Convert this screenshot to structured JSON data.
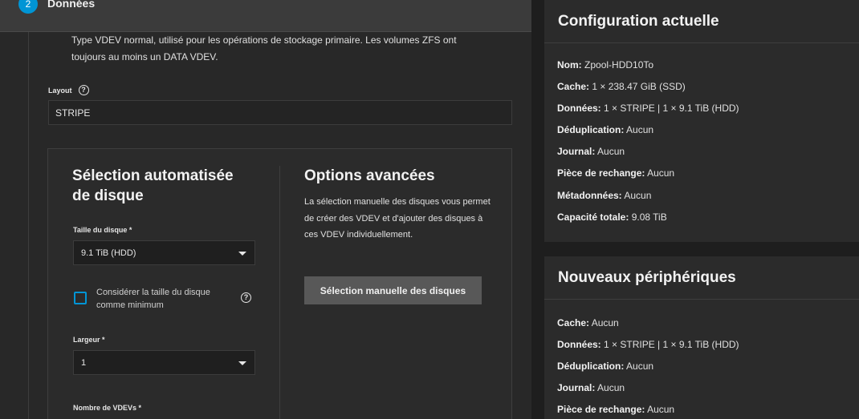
{
  "step": {
    "number": "2",
    "title": "Données"
  },
  "description": "Type VDEV normal, utilisé pour les opérations de stockage primaire. Les volumes ZFS ont toujours au moins un DATA VDEV.",
  "layout": {
    "label": "Layout",
    "value": "STRIPE"
  },
  "auto": {
    "title_line1": "Sélection automatisée",
    "title_line2": "de disque",
    "disk_size_label": "Taille du disque *",
    "disk_size_value": "9.1 TiB (HDD)",
    "min_checkbox_label": "Considérer la taille du disque comme minimum",
    "width_label": "Largeur *",
    "width_value": "1",
    "vdev_count_label": "Nombre de VDEVs *"
  },
  "advanced": {
    "title": "Options avancées",
    "description": "La sélection manuelle des disques vous permet de créer des VDEV et d'ajouter des disques à ces VDEV individuellement.",
    "button": "Sélection manuelle des disques"
  },
  "current_config": {
    "title": "Configuration actuelle",
    "rows": [
      {
        "label": "Nom:",
        "value": "Zpool-HDD10To"
      },
      {
        "label": "Cache:",
        "value": "1 × 238.47 GiB (SSD)"
      },
      {
        "label": "Données:",
        "value": "1 × STRIPE | 1 × 9.1 TiB (HDD)"
      },
      {
        "label": "Déduplication:",
        "value": "Aucun"
      },
      {
        "label": "Journal:",
        "value": "Aucun"
      },
      {
        "label": "Pièce de rechange:",
        "value": "Aucun"
      },
      {
        "label": "Métadonnées:",
        "value": "Aucun"
      },
      {
        "label": "Capacité totale:",
        "value": "9.08 TiB"
      }
    ]
  },
  "new_devices": {
    "title": "Nouveaux périphériques",
    "rows": [
      {
        "label": "Cache:",
        "value": "Aucun"
      },
      {
        "label": "Données:",
        "value": "1 × STRIPE | 1 × 9.1 TiB (HDD)"
      },
      {
        "label": "Déduplication:",
        "value": "Aucun"
      },
      {
        "label": "Journal:",
        "value": "Aucun"
      },
      {
        "label": "Pièce de rechange:",
        "value": "Aucun"
      }
    ]
  },
  "colors": {
    "accent": "#0095d5",
    "background": "#1e1e1e",
    "panel": "#2b2b2b"
  }
}
